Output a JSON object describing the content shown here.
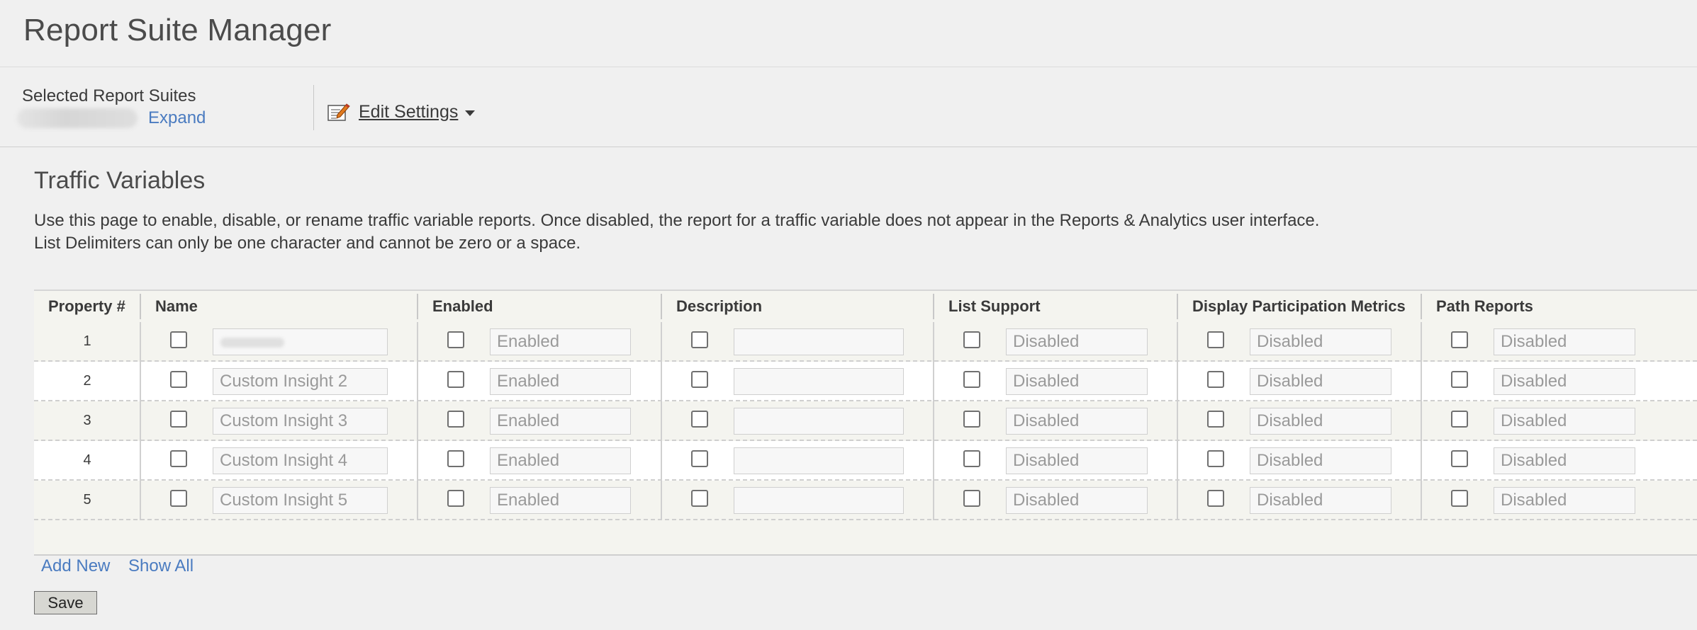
{
  "app": {
    "title": "Report Suite Manager"
  },
  "toolbar": {
    "selected_label": "Selected Report Suites",
    "expand_label": "Expand",
    "edit_settings_label": "Edit Settings"
  },
  "section": {
    "title": "Traffic Variables",
    "description_line1": "Use this page to enable, disable, or rename traffic variable reports. Once disabled, the report for a traffic variable does not appear in the Reports & Analytics user interface.",
    "description_line2": "List Delimiters can only be one character and cannot be zero or a space."
  },
  "table": {
    "columns": [
      "Property #",
      "Name",
      "Enabled",
      "Description",
      "List Support",
      "Display Participation Metrics",
      "Path Reports"
    ],
    "rows": [
      {
        "property": "1",
        "name": "",
        "enabled": "Enabled",
        "description": "",
        "list_support": "Disabled",
        "participation": "Disabled",
        "path_reports": "Disabled"
      },
      {
        "property": "2",
        "name": "Custom Insight 2",
        "enabled": "Enabled",
        "description": "",
        "list_support": "Disabled",
        "participation": "Disabled",
        "path_reports": "Disabled"
      },
      {
        "property": "3",
        "name": "Custom Insight 3",
        "enabled": "Enabled",
        "description": "",
        "list_support": "Disabled",
        "participation": "Disabled",
        "path_reports": "Disabled"
      },
      {
        "property": "4",
        "name": "Custom Insight 4",
        "enabled": "Enabled",
        "description": "",
        "list_support": "Disabled",
        "participation": "Disabled",
        "path_reports": "Disabled"
      },
      {
        "property": "5",
        "name": "Custom Insight 5",
        "enabled": "Enabled",
        "description": "",
        "list_support": "Disabled",
        "participation": "Disabled",
        "path_reports": "Disabled"
      }
    ]
  },
  "footer": {
    "add_new_label": "Add New",
    "show_all_label": "Show All",
    "save_label": "Save"
  },
  "colors": {
    "link": "#4a7bc0",
    "page_background": "#f0f0f0",
    "row_alt": "#f4f4ef"
  },
  "icons": {
    "edit_settings": "edit-settings-icon",
    "dropdown": "chevron-down-icon"
  }
}
